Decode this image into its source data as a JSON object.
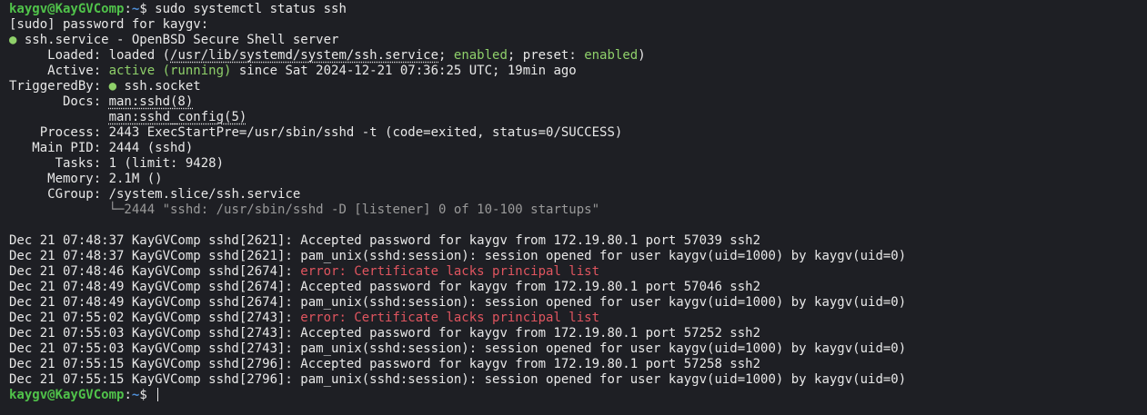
{
  "prompt": {
    "user": "kaygv@KayGVComp",
    "sep": ":",
    "path": "~",
    "sym": "$ "
  },
  "command": "sudo systemctl status ssh",
  "sudo_prompt": "[sudo] password for kaygv:",
  "unit": {
    "dot": "●",
    "title": " ssh.service - OpenBSD Secure Shell server"
  },
  "loaded": {
    "key": "     Loaded: ",
    "a": "loaded (",
    "path": "/usr/lib/systemd/system/ssh.service",
    "b": "; ",
    "c": "enabled",
    "d": "; preset: ",
    "e": "enabled",
    "f": ")"
  },
  "active": {
    "key": "     Active: ",
    "state": "active (running)",
    "rest": " since Sat 2024-12-21 07:36:25 UTC; 19min ago"
  },
  "triggered": {
    "key": "TriggeredBy: ",
    "dot": "●",
    "value": " ssh.socket"
  },
  "docs": {
    "key": "       Docs: ",
    "first": "man:sshd(8)",
    "indent": "             ",
    "second": "man:sshd_config(5)"
  },
  "process": {
    "key": "    Process: ",
    "value": "2443 ExecStartPre=/usr/sbin/sshd -t (code=exited, status=0/SUCCESS)"
  },
  "mainpid": {
    "key": "   Main PID: ",
    "value": "2444 (sshd)"
  },
  "tasks": {
    "key": "      Tasks: ",
    "value": "1 (limit: 9428)"
  },
  "memory": {
    "key": "     Memory: ",
    "value": "2.1M ()"
  },
  "cgroup": {
    "key": "     CGroup: ",
    "value": "/system.slice/ssh.service",
    "tree_indent": "             ",
    "tree": "└─2444 \"sshd: /usr/sbin/sshd -D [listener] 0 of 10-100 startups\""
  },
  "log": [
    {
      "prefix": "Dec 21 07:48:37 KayGVComp sshd[2621]: ",
      "msg": "Accepted password for kaygv from 172.19.80.1 port 57039 ssh2",
      "error": false
    },
    {
      "prefix": "Dec 21 07:48:37 KayGVComp sshd[2621]: ",
      "msg": "pam_unix(sshd:session): session opened for user kaygv(uid=1000) by kaygv(uid=0)",
      "error": false
    },
    {
      "prefix": "Dec 21 07:48:46 KayGVComp sshd[2674]: ",
      "msg": "error: Certificate lacks principal list",
      "error": true
    },
    {
      "prefix": "Dec 21 07:48:49 KayGVComp sshd[2674]: ",
      "msg": "Accepted password for kaygv from 172.19.80.1 port 57046 ssh2",
      "error": false
    },
    {
      "prefix": "Dec 21 07:48:49 KayGVComp sshd[2674]: ",
      "msg": "pam_unix(sshd:session): session opened for user kaygv(uid=1000) by kaygv(uid=0)",
      "error": false
    },
    {
      "prefix": "Dec 21 07:55:02 KayGVComp sshd[2743]: ",
      "msg": "error: Certificate lacks principal list",
      "error": true
    },
    {
      "prefix": "Dec 21 07:55:03 KayGVComp sshd[2743]: ",
      "msg": "Accepted password for kaygv from 172.19.80.1 port 57252 ssh2",
      "error": false
    },
    {
      "prefix": "Dec 21 07:55:03 KayGVComp sshd[2743]: ",
      "msg": "pam_unix(sshd:session): session opened for user kaygv(uid=1000) by kaygv(uid=0)",
      "error": false
    },
    {
      "prefix": "Dec 21 07:55:15 KayGVComp sshd[2796]: ",
      "msg": "Accepted password for kaygv from 172.19.80.1 port 57258 ssh2",
      "error": false
    },
    {
      "prefix": "Dec 21 07:55:15 KayGVComp sshd[2796]: ",
      "msg": "pam_unix(sshd:session): session opened for user kaygv(uid=1000) by kaygv(uid=0)",
      "error": false
    }
  ]
}
